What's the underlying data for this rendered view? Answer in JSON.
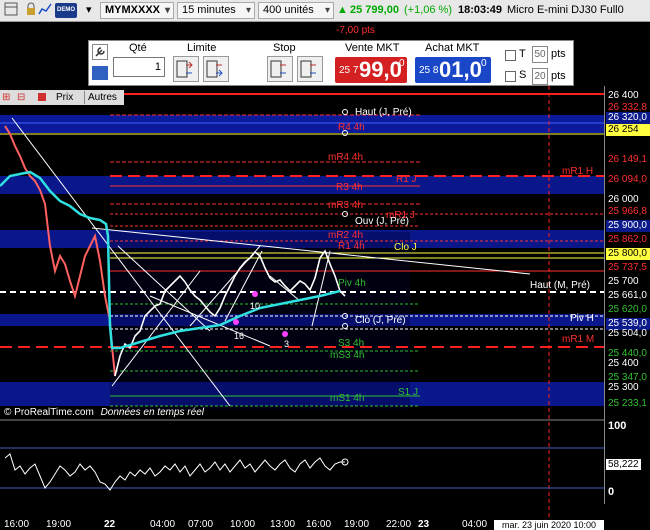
{
  "topbar": {
    "symbol": "MYMXXXX",
    "timeframe": "15 minutes",
    "units": "400 unités",
    "price": "25 799,00",
    "change": "(+1,06 %)",
    "time": "18:03:49",
    "instrument": "Micro E-mini DJ30 Full0",
    "demo": "DEMO"
  },
  "pnl": "-7,00 pts",
  "trade_panel": {
    "qty_label": "Qté",
    "qty_value": "1",
    "limit_label": "Limite",
    "stop_label": "Stop",
    "sell_label": "Vente MKT",
    "buy_label": "Achat MKT",
    "sell_small": "25 7",
    "sell_big": "99,0",
    "sell_sup": "0",
    "buy_small": "25 8",
    "buy_big": "01,0",
    "buy_sup": "0",
    "t_label": "T",
    "s_label": "S",
    "t_pts": "50",
    "s_pts": "20",
    "pts": "pts"
  },
  "chart_toolbar": {
    "price_label": "Prix",
    "others_label": "Autres"
  },
  "levels": {
    "haut_j_pre": "Haut (J, Pré)",
    "mr4": "mR4 4h",
    "r4": "R4 4h",
    "mr1h": "mR1 H",
    "r1j": "R1 J",
    "r3": "R3 4h",
    "mr3": "mR3 4h",
    "mr1j": "mR1 J",
    "ouv": "Ouv (J, Pré)",
    "mr2": "mR2 4h",
    "r1_4h": "R1 4h",
    "clo_j": "Clo J",
    "haut_m_pre": "Haut (M, Pré)",
    "piv": "Piv 4h",
    "piv_h": "Piv H",
    "clo_j_pre": "Clo (J, Pré)",
    "mr1m": "mR1 M",
    "s3": "S3 4h",
    "ms3": "mS3 4h",
    "s1j": "S1 J",
    "ms1": "mS1 4h",
    "bar_16": "16",
    "bar_10": "10",
    "bar_3": "3"
  },
  "watermark": "© ProRealTime.com",
  "realtime": "Données en temps réel",
  "yaxis": [
    {
      "v": "26 400",
      "c": "#ffffff",
      "bg": "transparent"
    },
    {
      "v": "26 332,8",
      "c": "#ff3030",
      "bg": "transparent"
    },
    {
      "v": "26 320,0",
      "c": "#ffffff",
      "bg": "#0a1a8a"
    },
    {
      "v": "26 254",
      "c": "#000000",
      "bg": "#ffff40"
    },
    {
      "v": "26 149,1",
      "c": "#ff3030",
      "bg": "transparent"
    },
    {
      "v": "26 094,0",
      "c": "#ff3030",
      "bg": "transparent"
    },
    {
      "v": "26 000",
      "c": "#ffffff",
      "bg": "transparent"
    },
    {
      "v": "25 966,8",
      "c": "#ff3030",
      "bg": "transparent"
    },
    {
      "v": "25 900,0",
      "c": "#ffffff",
      "bg": "#0a1a8a"
    },
    {
      "v": "25 862,0",
      "c": "#ff3030",
      "bg": "transparent"
    },
    {
      "v": "25 800,0",
      "c": "#000000",
      "bg": "#ffff40"
    },
    {
      "v": "25 737,5",
      "c": "#ff3030",
      "bg": "transparent"
    },
    {
      "v": "25 700",
      "c": "#ffffff",
      "bg": "transparent"
    },
    {
      "v": "25 661,0",
      "c": "#ffffff",
      "bg": "transparent"
    },
    {
      "v": "25 620,0",
      "c": "#30c030",
      "bg": "transparent"
    },
    {
      "v": "25 539,0",
      "c": "#ffffff",
      "bg": "#0a1a8a"
    },
    {
      "v": "25 504,0",
      "c": "#ffffff",
      "bg": "transparent"
    },
    {
      "v": "25 440,0",
      "c": "#30c030",
      "bg": "transparent"
    },
    {
      "v": "25 400",
      "c": "#ffffff",
      "bg": "transparent"
    },
    {
      "v": "25 347,0",
      "c": "#30c030",
      "bg": "transparent"
    },
    {
      "v": "25 300",
      "c": "#ffffff",
      "bg": "transparent"
    },
    {
      "v": "25 233,1",
      "c": "#30c030",
      "bg": "transparent"
    }
  ],
  "indicator_axis": [
    "100",
    "58,222",
    "0"
  ],
  "xaxis": [
    "16:00",
    "19:00",
    "22",
    "04:00",
    "07:00",
    "10:00",
    "13:00",
    "16:00",
    "19:00",
    "22:00",
    "23",
    "04:00"
  ],
  "xaxis_date": "mar. 23 juin 2020 10:00"
}
